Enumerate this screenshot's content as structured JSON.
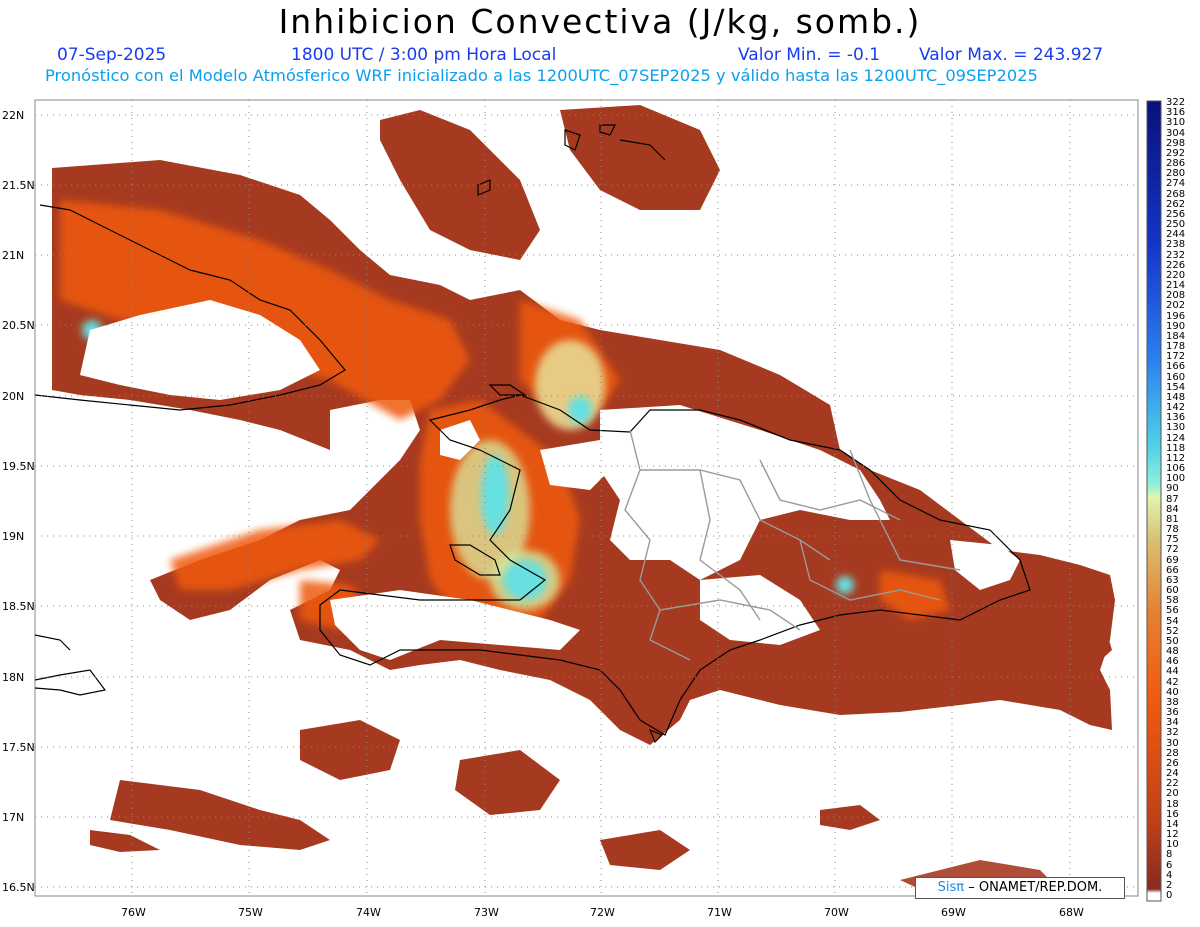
{
  "header": {
    "title": "Inhibicion Convectiva (J/kg, somb.)",
    "date": "07-Sep-2025",
    "time": "1800 UTC / 3:00 pm Hora Local",
    "valor_min": "Valor Min. = -0.1",
    "valor_max": "Valor Max. = 243.927",
    "description": "Pronóstico con el Modelo Atmósferico WRF inicializado a las 1200UTC_07SEP2025 y válido hasta las  1200UTC_09SEP2025"
  },
  "map": {
    "lat_labels": [
      "22N",
      "21.5N",
      "21N",
      "20.5N",
      "20N",
      "19.5N",
      "19N",
      "18.5N",
      "18N",
      "17.5N",
      "17N",
      "16.5N"
    ],
    "lon_labels": [
      "76W",
      "75W",
      "74W",
      "73W",
      "72W",
      "71W",
      "70W",
      "69W",
      "68W"
    ]
  },
  "colorbar": {
    "labels": [
      "322",
      "316",
      "310",
      "304",
      "298",
      "292",
      "286",
      "280",
      "274",
      "268",
      "262",
      "256",
      "250",
      "244",
      "238",
      "232",
      "226",
      "220",
      "214",
      "208",
      "202",
      "196",
      "190",
      "184",
      "178",
      "172",
      "166",
      "160",
      "154",
      "148",
      "142",
      "136",
      "130",
      "124",
      "118",
      "112",
      "106",
      "100",
      "90",
      "87",
      "84",
      "81",
      "78",
      "75",
      "72",
      "69",
      "66",
      "63",
      "60",
      "58",
      "56",
      "54",
      "52",
      "50",
      "48",
      "46",
      "44",
      "42",
      "40",
      "38",
      "36",
      "34",
      "32",
      "30",
      "28",
      "26",
      "24",
      "22",
      "20",
      "18",
      "16",
      "14",
      "12",
      "10",
      "8",
      "6",
      "4",
      "2",
      "0"
    ],
    "colors": {
      "deep_blue": "#08117a",
      "blue": "#1e5cf0",
      "cyan": "#5ee0e6",
      "pale_green": "#d2f0a0",
      "tan": "#d9b070",
      "orange": "#f05a10",
      "dark_red": "#a63a20"
    }
  },
  "credit": {
    "sis": "Sisπ",
    "rest": "– ONAMET/REP.DOM."
  }
}
